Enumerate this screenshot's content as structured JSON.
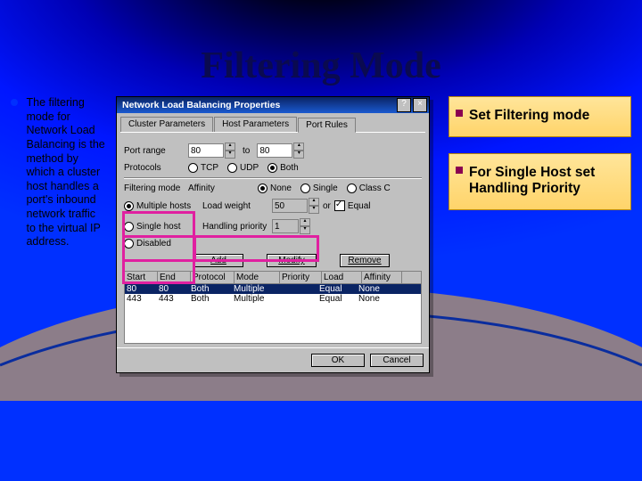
{
  "title": "Filtering Mode",
  "bullet": "The filtering mode for Network Load Balancing is the method by which a cluster host handles a port's inbound network traffic to the virtual IP address.",
  "callouts": {
    "a": "Set Filtering mode",
    "b": "For Single Host set Handling Priority"
  },
  "dialog": {
    "title": "Network Load Balancing Properties",
    "tabs": {
      "a": "Cluster Parameters",
      "b": "Host Parameters",
      "c": "Port Rules"
    },
    "labels": {
      "portrange": "Port range",
      "to": "to",
      "protocols": "Protocols",
      "tcp": "TCP",
      "udp": "UDP",
      "both": "Both",
      "filtering": "Filtering mode",
      "affinity": "Affinity",
      "none": "None",
      "single": "Single",
      "classc": "Class C",
      "multiple": "Multiple hosts",
      "loadweight": "Load weight",
      "or": "or",
      "equal": "Equal",
      "singlehost": "Single host",
      "handling": "Handling priority",
      "disabled": "Disabled",
      "add": "Add",
      "modify": "Modify",
      "remove": "Remove",
      "ok": "OK",
      "cancel": "Cancel"
    },
    "values": {
      "port_from": "80",
      "port_to": "80",
      "loadweight": "50",
      "priority": "1"
    },
    "headers": {
      "start": "Start",
      "end": "End",
      "protocol": "Protocol",
      "mode": "Mode",
      "priority": "Priority",
      "load": "Load",
      "affinity": "Affinity"
    },
    "rows": [
      {
        "start": "80",
        "end": "80",
        "protocol": "Both",
        "mode": "Multiple",
        "priority": "",
        "load": "Equal",
        "affinity": "None"
      },
      {
        "start": "443",
        "end": "443",
        "protocol": "Both",
        "mode": "Multiple",
        "priority": "",
        "load": "Equal",
        "affinity": "None"
      }
    ]
  }
}
